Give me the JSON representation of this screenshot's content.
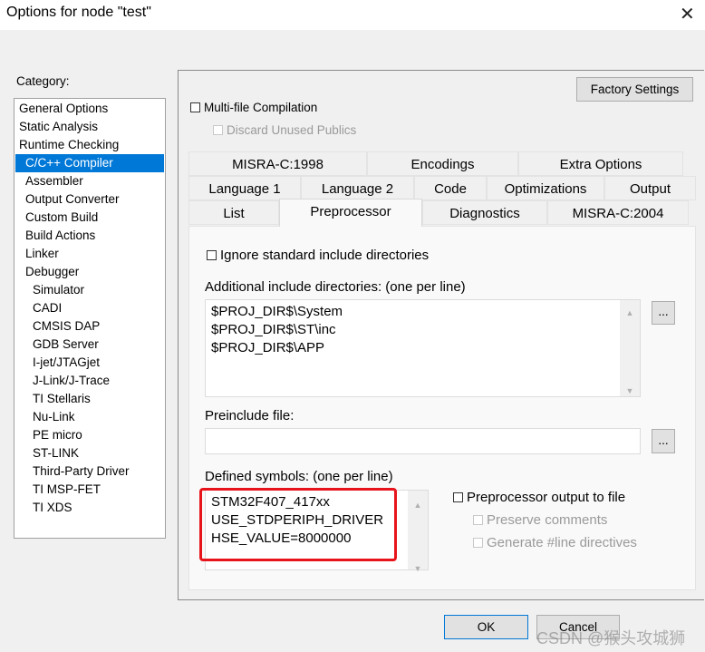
{
  "window": {
    "title": "Options for node \"test\"",
    "close": "✕"
  },
  "category": {
    "label": "Category:",
    "items": [
      "General Options",
      "Static Analysis",
      "Runtime Checking",
      "C/C++ Compiler",
      "Assembler",
      "Output Converter",
      "Custom Build",
      "Build Actions",
      "Linker",
      "Debugger",
      "Simulator",
      "CADI",
      "CMSIS DAP",
      "GDB Server",
      "I-jet/JTAGjet",
      "J-Link/J-Trace",
      "TI Stellaris",
      "Nu-Link",
      "PE micro",
      "ST-LINK",
      "Third-Party Driver",
      "TI MSP-FET",
      "TI XDS"
    ],
    "selected": "C/C++ Compiler",
    "accent": "#0078d7"
  },
  "top": {
    "factory": "Factory Settings",
    "multifile": "Multi-file Compilation",
    "discard": "Discard Unused Publics"
  },
  "tabs": {
    "row1": [
      "MISRA-C:1998",
      "Encodings",
      "Extra Options"
    ],
    "row2": [
      "Language 1",
      "Language 2",
      "Code",
      "Optimizations",
      "Output"
    ],
    "row3": [
      "List",
      "Preprocessor",
      "Diagnostics",
      "MISRA-C:2004"
    ],
    "active": "Preprocessor"
  },
  "pre": {
    "ignore": "Ignore standard include directories",
    "include_label": "Additional include directories: (one per line)",
    "include_value": "$PROJ_DIR$\\System\n$PROJ_DIR$\\ST\\inc\n$PROJ_DIR$\\APP",
    "preinclude_label": "Preinclude file:",
    "preinclude_value": "",
    "browse": "...",
    "defined_label": "Defined symbols: (one per line)",
    "defined_value": "STM32F407_417xx\nUSE_STDPERIPH_DRIVER\nHSE_VALUE=8000000",
    "output_file": "Preprocessor output to file",
    "preserve": "Preserve comments",
    "genline": "Generate #line directives",
    "highlight": "#e8141b"
  },
  "buttons": {
    "ok": "OK",
    "cancel": "Cancel"
  },
  "watermark": "CSDN @猴头攻城狮"
}
